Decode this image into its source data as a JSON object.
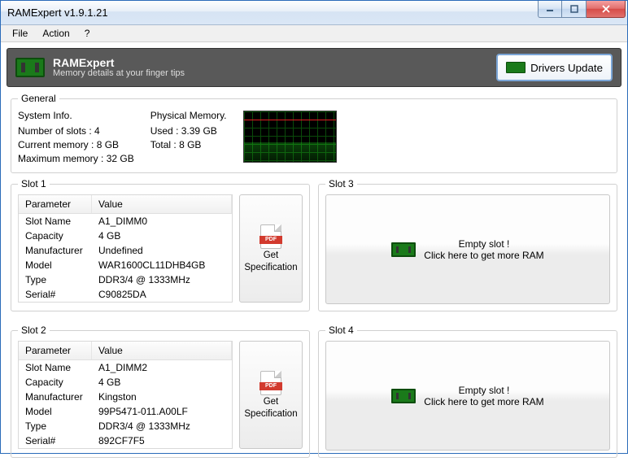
{
  "window": {
    "title": "RAMExpert v1.9.1.21"
  },
  "menu": {
    "file": "File",
    "action": "Action",
    "help": "?"
  },
  "header": {
    "title": "RAMExpert",
    "subtitle": "Memory details at your finger tips",
    "drivers_btn": "Drivers Update"
  },
  "general": {
    "legend": "General",
    "system_label": "System Info.",
    "num_slots_label": "Number of slots :",
    "num_slots_value": "4",
    "current_mem_label": "Current memory :",
    "current_mem_value": "8 GB",
    "max_mem_label": "Maximum memory :",
    "max_mem_value": "32 GB",
    "phys_label": "Physical Memory.",
    "used_label": "Used :",
    "used_value": "3.39 GB",
    "total_label": "Total :",
    "total_value": "8 GB"
  },
  "table_hdr": {
    "param": "Parameter",
    "value": "Value"
  },
  "row_labels": {
    "slot_name": "Slot Name",
    "capacity": "Capacity",
    "manufacturer": "Manufacturer",
    "model": "Model",
    "type": "Type",
    "serial": "Serial#"
  },
  "spec_btn": {
    "pdf": "PDF",
    "l1": "Get",
    "l2": "Specification"
  },
  "empty": {
    "l1": "Empty slot !",
    "l2": "Click here to get more RAM"
  },
  "slots": {
    "s1": {
      "legend": "Slot 1",
      "slot_name": "A1_DIMM0",
      "capacity": "4 GB",
      "manufacturer": "Undefined",
      "model": "WAR1600CL11DHB4GB",
      "type": "DDR3/4 @ 1333MHz",
      "serial": "C90825DA"
    },
    "s2": {
      "legend": "Slot 2",
      "slot_name": "A1_DIMM2",
      "capacity": "4 GB",
      "manufacturer": "Kingston",
      "model": "99P5471-011.A00LF",
      "type": "DDR3/4 @ 1333MHz",
      "serial": "892CF7F5"
    },
    "s3": {
      "legend": "Slot 3"
    },
    "s4": {
      "legend": "Slot 4"
    }
  }
}
